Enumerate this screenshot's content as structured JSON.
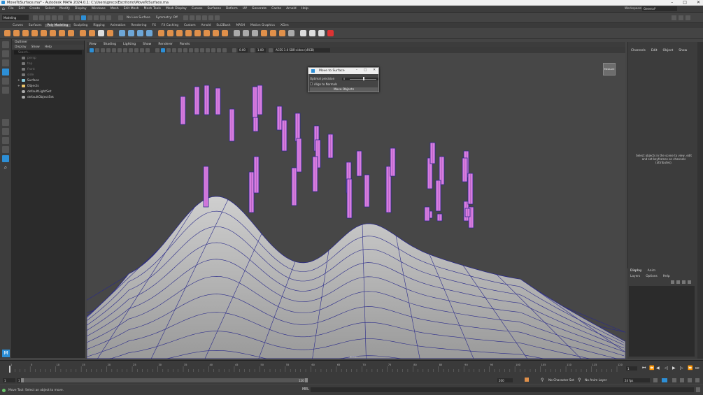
{
  "window": {
    "title": "MoveToSurface.ma* - Autodesk MAYA 2024.0.1: C:\\Users\\greco\\Escritorio\\MoveToSurface.ma",
    "workspace_label": "Workspace:",
    "workspace_value": "General*",
    "controls": [
      "–",
      "□",
      "✕"
    ]
  },
  "menubar": {
    "items": [
      "File",
      "Edit",
      "Create",
      "Select",
      "Modify",
      "Display",
      "Windows",
      "Mesh",
      "Edit Mesh",
      "Mesh Tools",
      "Mesh Display",
      "Curves",
      "Surfaces",
      "Deform",
      "UV",
      "Generate",
      "Cache",
      "Arnold",
      "Help"
    ]
  },
  "statusline": {
    "mode": "Modeling",
    "no_live": "No Live Surface",
    "symmetry": "Symmetry: Off"
  },
  "shelf": {
    "tabs": [
      "Curves",
      "Surfaces",
      "Poly Modeling",
      "Sculpting",
      "Rigging",
      "Animation",
      "Rendering",
      "FX",
      "FX Caching",
      "Custom",
      "Arnold",
      "Sui2Bush",
      "MASH",
      "Motion Graphics",
      "XGen"
    ],
    "active": 2
  },
  "outliner": {
    "title": "Outliner",
    "menu": [
      "Display",
      "Show",
      "Help"
    ],
    "search_placeholder": "Search...",
    "items": [
      {
        "label": "persp",
        "dim": true
      },
      {
        "label": "top",
        "dim": true
      },
      {
        "label": "front",
        "dim": true
      },
      {
        "label": "side",
        "dim": true
      },
      {
        "label": "Surface",
        "dim": false
      },
      {
        "label": "Objects",
        "dim": false
      },
      {
        "label": "defaultLightSet",
        "dim": false
      },
      {
        "label": "defaultObjectSet",
        "dim": false
      }
    ]
  },
  "viewport": {
    "menu": [
      "View",
      "Shading",
      "Lighting",
      "Show",
      "Renderer",
      "Panels"
    ],
    "values": {
      "exposure": "0.00",
      "gamma": "1.00"
    },
    "colorspace": "ACES 1.0 SDR-video (sRGB)",
    "camera_label": "persp",
    "cam_button": "Measure"
  },
  "dialog": {
    "title": "Move to Surface",
    "controls": [
      "–",
      "□",
      "✕"
    ],
    "precision_label": "Optimal precision",
    "precision_value": "0",
    "align_label": "Align to Normals",
    "button": "Move Objects"
  },
  "channel": {
    "menu": [
      "Channels",
      "Edit",
      "Object",
      "Show"
    ],
    "message": "Select objects in the scene to view, edit and set keyframes on channels (attributes)."
  },
  "layers": {
    "tabs": [
      "Display",
      "Anim"
    ],
    "menu": [
      "Layers",
      "Options",
      "Help"
    ]
  },
  "timeline": {
    "ticks": [
      "1",
      "5",
      "10",
      "15",
      "20",
      "25",
      "30",
      "35",
      "40",
      "45",
      "50",
      "55",
      "60",
      "65",
      "70",
      "75",
      "80",
      "85",
      "90",
      "95",
      "100",
      "105",
      "110",
      "115",
      "120"
    ],
    "current": "1"
  },
  "range": {
    "start": "1",
    "start_in": "1",
    "end_in": "120",
    "end": "200",
    "char_set": "No Character Set",
    "anim_layer": "No Anim Layer",
    "fps": "24 fps"
  },
  "command": {
    "lang": "MEL",
    "help": "Move Tool: Select an object to move."
  },
  "colors": {
    "accent": "#2d8fd6",
    "pillar": "#d77ce0",
    "wire": "#2a2a8a",
    "surface": "#bcbcbc",
    "shelf_orange": "#e0904a"
  }
}
